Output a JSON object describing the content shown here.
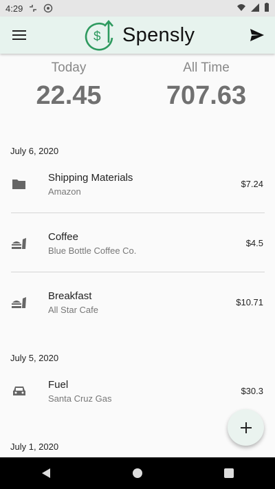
{
  "status_bar": {
    "time": "4:29"
  },
  "app_bar": {
    "brand": "Spensly"
  },
  "summary": {
    "today_label": "Today",
    "today_value": "22.45",
    "all_time_label": "All Time",
    "all_time_value": "707.63"
  },
  "groups": [
    {
      "date": "July 6, 2020",
      "items": [
        {
          "title": "Shipping Materials",
          "subtitle": "Amazon",
          "amount": "$7.24",
          "icon": "folder-icon"
        },
        {
          "title": "Coffee",
          "subtitle": "Blue Bottle Coffee Co.",
          "amount": "$4.5",
          "icon": "food-icon"
        },
        {
          "title": "Breakfast",
          "subtitle": "All Star Cafe",
          "amount": "$10.71",
          "icon": "food-icon"
        }
      ]
    },
    {
      "date": "July 5, 2020",
      "items": [
        {
          "title": "Fuel",
          "subtitle": "Santa Cruz Gas",
          "amount": "$30.3",
          "icon": "car-icon"
        }
      ]
    },
    {
      "date": "July 1, 2020",
      "items": []
    }
  ],
  "colors": {
    "app_bar_bg": "#e7f3ee",
    "logo_green": "#2e9a5f",
    "summary_value": "#707070"
  }
}
